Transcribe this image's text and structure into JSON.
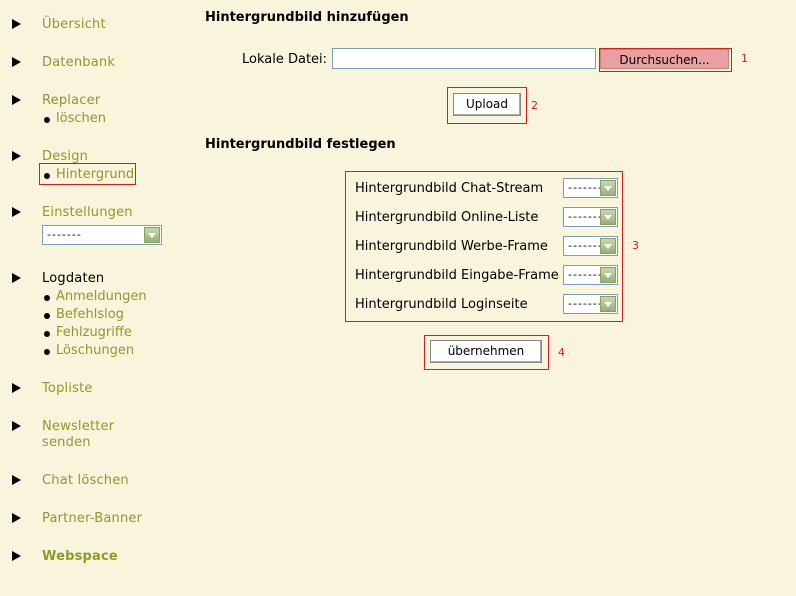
{
  "sidebar": {
    "items": [
      {
        "label": "Übersicht"
      },
      {
        "label": "Datenbank"
      },
      {
        "label": "Replacer",
        "subs": [
          "löschen"
        ]
      },
      {
        "label": "Design",
        "subs": [
          "Hintergrund"
        ]
      },
      {
        "label": "Einstellungen",
        "select_value": "-------"
      },
      {
        "label": "Logdaten",
        "subs": [
          "Anmeldungen",
          "Befehlslog",
          "Fehlzugriffe",
          "Löschungen"
        ]
      },
      {
        "label": "Topliste"
      },
      {
        "label": "Newsletter",
        "label2": "senden"
      },
      {
        "label": "Chat löschen"
      },
      {
        "label": "Partner-Banner"
      },
      {
        "label": "Webspace"
      }
    ]
  },
  "upload_section": {
    "heading": "Hintergrundbild hinzufügen",
    "file_label": "Lokale Datei:",
    "file_value": "",
    "browse_label": "Durchsuchen...",
    "upload_label": "Upload"
  },
  "assign_section": {
    "heading": "Hintergrundbild festlegen",
    "rows": [
      {
        "label": "Hintergrundbild Chat-Stream",
        "value": "-------"
      },
      {
        "label": "Hintergrundbild Online-Liste",
        "value": "-------"
      },
      {
        "label": "Hintergrundbild Werbe-Frame",
        "value": "-------"
      },
      {
        "label": "Hintergrundbild Eingabe-Frame",
        "value": "-------"
      },
      {
        "label": "Hintergrundbild Loginseite",
        "value": "-------"
      }
    ],
    "apply_label": "übernehmen"
  },
  "annotations": [
    "1",
    "2",
    "3",
    "4"
  ],
  "colors": {
    "background": "#f8f5dc",
    "link": "#8c9a2c",
    "highlight": "#d21e1e",
    "browse": "#e8a0a0"
  }
}
